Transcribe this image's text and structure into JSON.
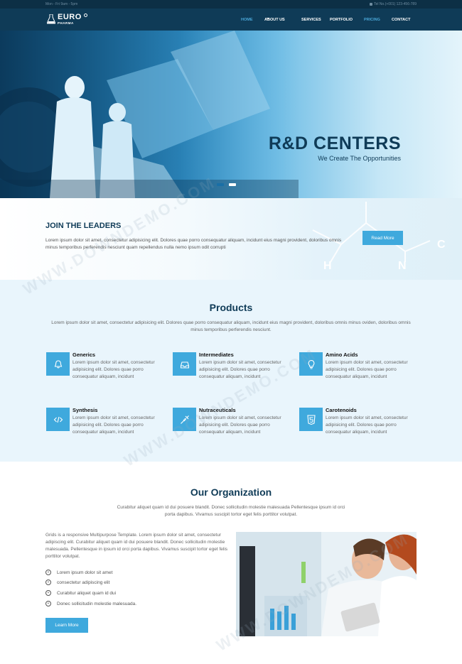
{
  "topbar": {
    "hours": "Mon - Fri 9am - 5pm",
    "phone": "Tel No.(+001) 123-456-789"
  },
  "brand": {
    "name": "EURO",
    "sub": "PHARMA"
  },
  "nav": {
    "items": [
      {
        "label": "HOME",
        "active": true
      },
      {
        "label": "ABOUT US",
        "has_dropdown": true
      },
      {
        "label": "SERVICES"
      },
      {
        "label": "PORTFOLIO"
      },
      {
        "label": "PRICING",
        "highlight": true
      },
      {
        "label": "CONTACT"
      }
    ]
  },
  "hero": {
    "title": "R&D CENTERS",
    "subtitle": "We Create The Opportunities",
    "slides": 2,
    "active_slide": 1
  },
  "join": {
    "title": "JOIN THE LEADERS",
    "text": "Lorem ipsum dolor sit amet, consectetur adipisicing elit. Dolores quae porro consequatur aliquam, incidunt eius magni provident, doloribus omnis minus temporibus perferendis nesciunt quam repellendus nulla nemo ipsum odit corrupti",
    "button": "Read More"
  },
  "products": {
    "title": "Products",
    "intro": "Lorem ipsum dolor sit amet, consectetur adipisicing elit. Dolores quae porro consequatur aliquam, incidunt eius magni provident, doloribus omnis minus oviden, doloribus omnis minus temporibus perferendis nesciunt.",
    "items": [
      {
        "name": "Generics",
        "icon": "bell-icon",
        "desc": "Lorem ipsum dolor sit amet, consectetur adipisicing elit. Dolores quae porro consequatur aliquam, incidunt"
      },
      {
        "name": "Intermediates",
        "icon": "inbox-icon",
        "desc": "Lorem ipsum dolor sit amet, consectetur adipisicing elit. Dolores quae porro consequatur aliquam, incidunt"
      },
      {
        "name": "Amino Acids",
        "icon": "lightbulb-icon",
        "desc": "Lorem ipsum dolor sit amet, consectetur adipisicing elit. Dolores quae porro consequatur aliquam, incidunt"
      },
      {
        "name": "Synthesis",
        "icon": "code-icon",
        "desc": "Lorem ipsum dolor sit amet, consectetur adipisicing elit. Dolores quae porro consequatur aliquam, incidunt"
      },
      {
        "name": "Nutraceuticals",
        "icon": "syringe-icon",
        "desc": "Lorem ipsum dolor sit amet, consectetur adipisicing elit. Dolores quae porro consequatur aliquam, incidunt"
      },
      {
        "name": "Carotenoids",
        "icon": "html5-icon",
        "desc": "Lorem ipsum dolor sit amet, consectetur adipisicing elit. Dolores quae porro consequatur aliquam, incidunt"
      }
    ]
  },
  "organization": {
    "title": "Our Organization",
    "intro": "Curabitur aliquet quam id dui posuere blandit. Donec sollicitudin molestie malesuada Pellentesque ipsum id orci porta dapibus. Vivamus suscipit tortor eget felis porttitor volutpat.",
    "text": "Grids is a responsive Multipurpose Template. Lorem ipsum dolor sit amet, consectetur adipiscing elit. Curabitur aliquet quam id dui posuere blandit. Donec sollicitudin molestie malesuada. Pellentesque in ipsum id orci porta dapibus. Vivamus suscipit tortor eget felis porttitor volutpat.",
    "list": [
      "Lorem ipsum dolor sit amet",
      "consectetur adipiscing elit",
      "Curabitur aliquet quam id dui",
      "Donec sollicitudin molestie malesuada."
    ],
    "button": "Learn More"
  },
  "watermark": "WWW.DOWNDEMO.COM",
  "colors": {
    "accent": "#3fa9dd",
    "navy": "#0f3b57",
    "topbar": "#0c2f45",
    "products_bg": "#e9f5fc"
  }
}
